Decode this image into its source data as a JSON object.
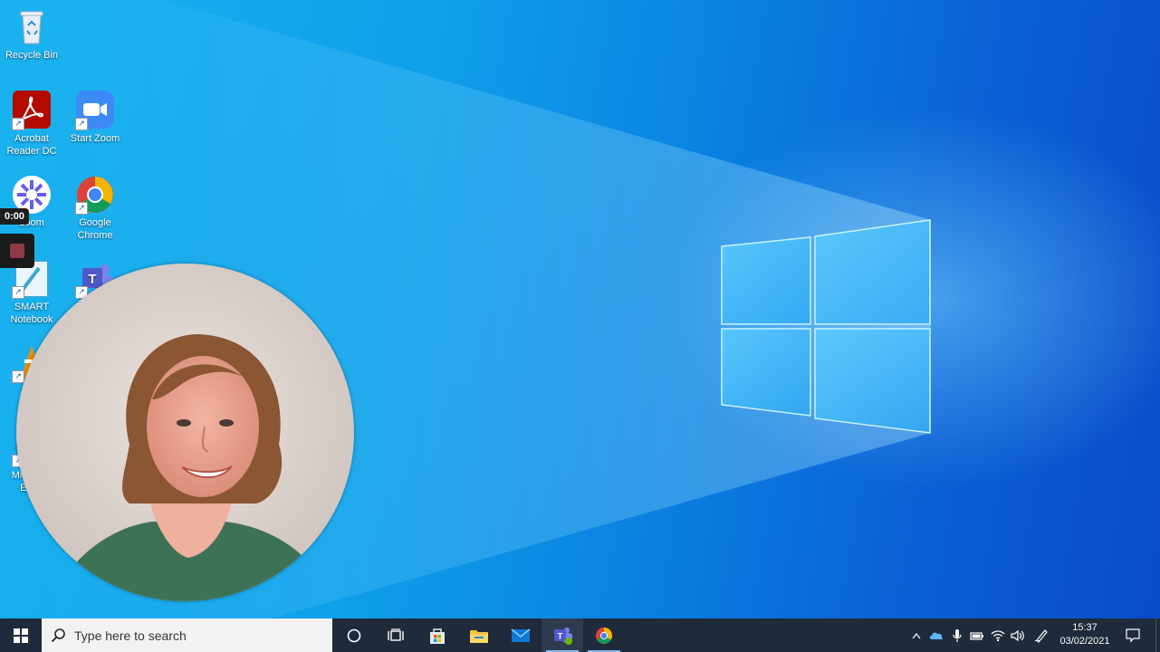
{
  "desktop": {
    "icons": [
      {
        "label": "Recycle Bin",
        "icon": "recycle-bin-icon"
      },
      {
        "label": "Acrobat Reader DC",
        "icon": "acrobat-icon"
      },
      {
        "label": "Start Zoom",
        "icon": "zoom-icon"
      },
      {
        "label": "Loom",
        "icon": "loom-icon"
      },
      {
        "label": "Google Chrome",
        "icon": "chrome-icon"
      },
      {
        "label": "SMART Notebook",
        "icon": "smart-notebook-icon"
      },
      {
        "label": "Teams",
        "icon": "teams-icon"
      },
      {
        "label": "VLC",
        "icon": "vlc-icon"
      },
      {
        "label": "Microsoft Edge",
        "icon": "edge-icon"
      }
    ]
  },
  "recorder": {
    "time": "0:00",
    "stop_icon": "stop-icon"
  },
  "taskbar": {
    "search_placeholder": "Type here to search",
    "apps": [
      "cortana-icon",
      "task-view-icon",
      "store-icon",
      "file-explorer-icon",
      "mail-icon",
      "teams-icon",
      "chrome-icon"
    ],
    "tray": [
      "chevron-up-icon",
      "onedrive-icon",
      "microphone-icon",
      "battery-icon",
      "wifi-icon",
      "volume-icon",
      "pen-icon"
    ],
    "clock_time": "15:37",
    "clock_date": "03/02/2021",
    "notification_icon": "notification-icon"
  },
  "colors": {
    "taskbar": "#1f2a3a",
    "desktop_accent": "#0a7fe0"
  }
}
